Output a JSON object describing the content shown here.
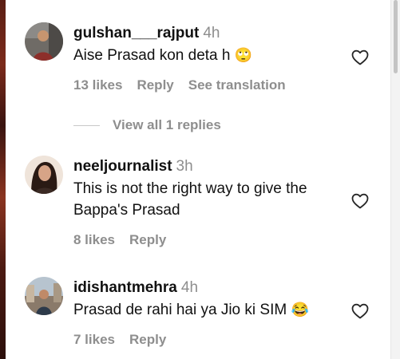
{
  "comments": [
    {
      "username": "gulshan___rajput",
      "time": "4h",
      "text": "Aise Prasad kon deta h",
      "emoji": "🙄",
      "likes": "13 likes",
      "reply": "Reply",
      "translation": "See translation"
    },
    {
      "username": "neeljournalist",
      "time": "3h",
      "text": "This is not the right way to give the Bappa's Prasad",
      "likes": "8 likes",
      "reply": "Reply"
    },
    {
      "username": "idishantmehra",
      "time": "4h",
      "text": "Prasad de rahi hai ya Jio ki SIM",
      "emoji": "😂",
      "likes": "7 likes",
      "reply": "Reply"
    }
  ],
  "view_replies": "View all 1 replies",
  "icons": {
    "like": "heart-icon"
  },
  "colors": {
    "muted": "#8e8e8e",
    "text": "#111111"
  }
}
